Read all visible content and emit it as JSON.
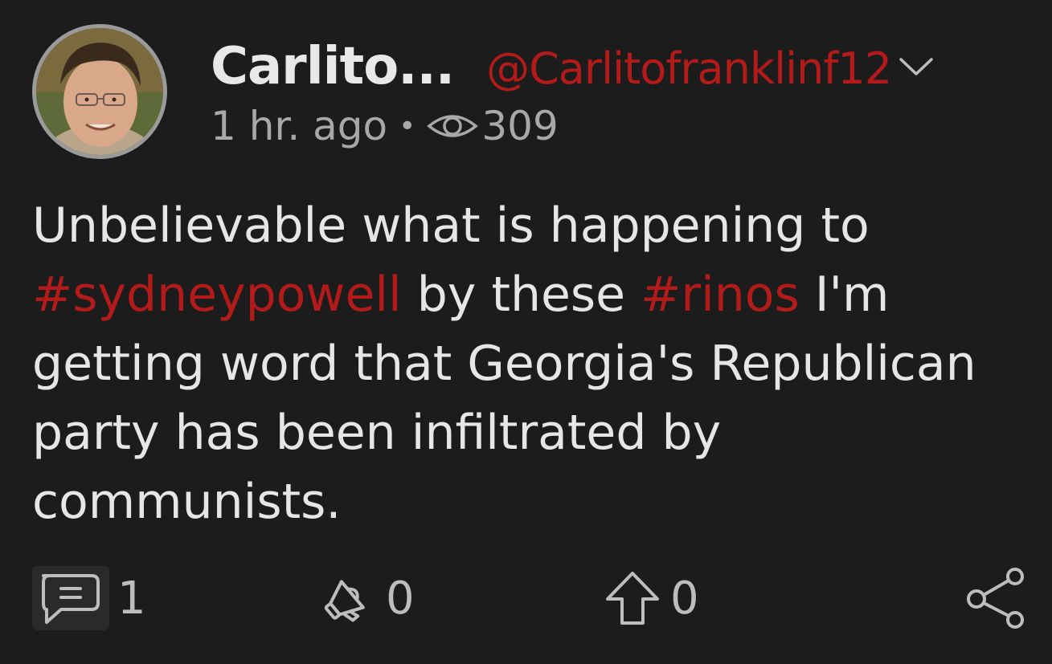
{
  "post": {
    "author": {
      "display_name": "Carlito...",
      "handle": "@Carlitofranklinf12"
    },
    "timestamp": "1 hr. ago",
    "separator": "•",
    "views": "309",
    "body": {
      "segments": [
        {
          "text": "Unbelievable what is happening to ",
          "type": "text"
        },
        {
          "text": "#sydneypowell",
          "type": "hashtag"
        },
        {
          "text": " by these ",
          "type": "text"
        },
        {
          "text": "#rinos",
          "type": "hashtag"
        },
        {
          "text": " I'm getting word that Georgia's Republican party has been infiltrated by communists.",
          "type": "text"
        }
      ]
    },
    "actions": {
      "comments": "1",
      "boosts": "0",
      "upvotes": "0"
    }
  },
  "colors": {
    "background": "#1c1c1c",
    "accent": "#b31b1b",
    "text": "#e6e6e6",
    "muted": "#a8a8a8"
  },
  "icons": {
    "views": "eye-icon",
    "menu": "chevron-down-icon",
    "comment": "comment-icon",
    "boost": "megaphone-icon",
    "upvote": "arrow-up-icon",
    "share": "share-icon"
  }
}
